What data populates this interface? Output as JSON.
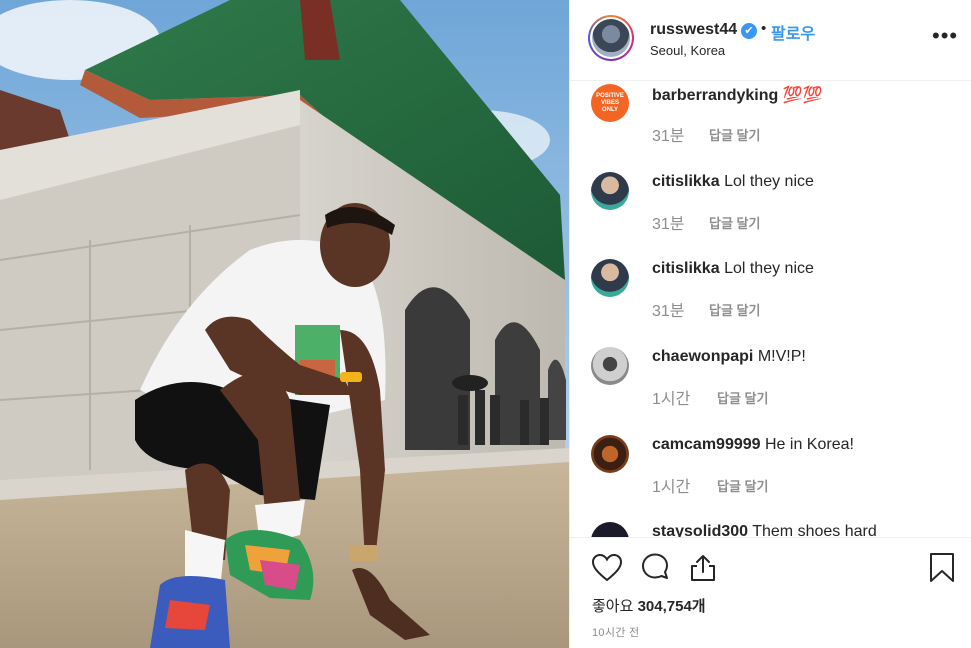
{
  "post": {
    "username": "russwest44",
    "verified_badge": "✔",
    "separator": "•",
    "follow_label": "팔로우",
    "location": "Seoul, Korea",
    "more_label": "•••",
    "like_label": "좋아요",
    "like_count": "304,754개",
    "posted_ago": "10시간 전"
  },
  "comments": [
    {
      "user": "barberrandyking",
      "text": "💯💯",
      "time": "31분",
      "reply": "답글 달기",
      "avatar_label": "POSITIVE VIBES ONLY"
    },
    {
      "user": "citislikka",
      "text": "Lol they nice",
      "time": "31분",
      "reply": "답글 달기"
    },
    {
      "user": "citislikka",
      "text": "Lol they nice",
      "time": "31분",
      "reply": "답글 달기"
    },
    {
      "user": "chaewonpapi",
      "text": "M!V!P!",
      "time": "1시간",
      "reply": "답글 달기"
    },
    {
      "user": "camcam99999",
      "text": "He in Korea!",
      "time": "1시간",
      "reply": "답글 달기"
    },
    {
      "user": "staysolid300",
      "text": "Them shoes hard",
      "time": "",
      "reply": ""
    }
  ],
  "icons": {
    "like": "heart-icon",
    "comment": "comment-bubble-icon",
    "share": "share-icon",
    "save": "bookmark-icon",
    "verified": "verified-badge-icon",
    "options": "more-options-icon"
  },
  "colors": {
    "link_blue": "#3897f0",
    "text": "#262626",
    "muted": "#8e8e8e",
    "border": "#efefef"
  }
}
